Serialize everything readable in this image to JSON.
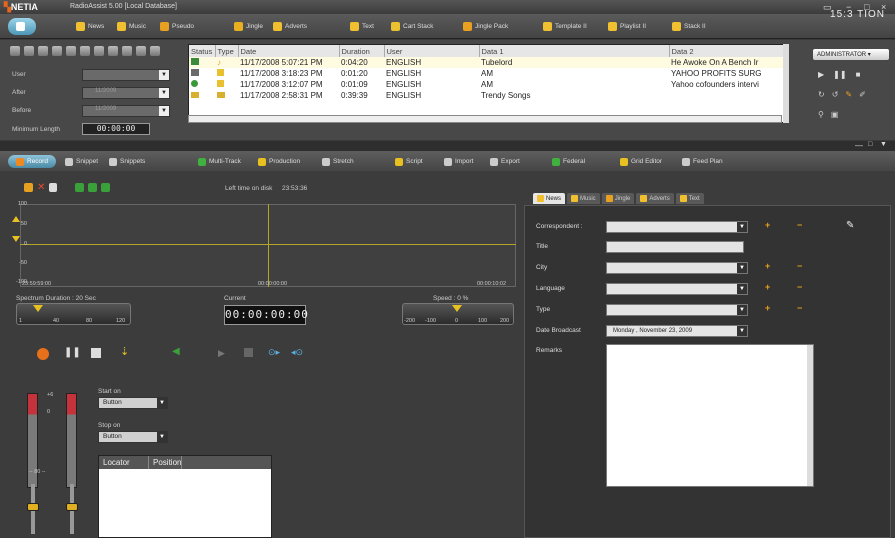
{
  "title_bar": {
    "logo": "NETIA",
    "window_title": "RadioAssist 5.00 [Local Database]",
    "controls": [
      "▭",
      "−",
      "□",
      "×"
    ]
  },
  "modules": [
    {
      "label": "",
      "icon": "home-icon",
      "color": "#ffffff",
      "active": true
    },
    {
      "label": "News",
      "icon": "news-icon",
      "color": "#f0c030"
    },
    {
      "label": "Music",
      "icon": "music-icon",
      "color": "#f0c030"
    },
    {
      "label": "Pseudo",
      "icon": "pseudo-icon",
      "color": "#e8a020"
    },
    {
      "label": "Jingle",
      "icon": "jingle-icon",
      "color": "#e8b020"
    },
    {
      "label": "Adverts",
      "icon": "adverts-icon",
      "color": "#f0c030"
    },
    {
      "label": "Text",
      "icon": "text-icon",
      "color": "#f0c030"
    },
    {
      "label": "Cart Stack",
      "icon": "cart-stack-icon",
      "color": "#e8c030"
    },
    {
      "label": "Jingle Pack",
      "icon": "jingle-pack-icon",
      "color": "#e8a020"
    },
    {
      "label": "Template II",
      "icon": "template-icon",
      "color": "#f0c030"
    },
    {
      "label": "Playlist II",
      "icon": "playlist-icon",
      "color": "#f0c030"
    },
    {
      "label": "Stack II",
      "icon": "stack-icon",
      "color": "#f0c030"
    }
  ],
  "clock": "15:3 TION",
  "filters": {
    "user_label": "User",
    "after_label": "After",
    "before_label": "Before",
    "after_value": "11/2009",
    "before_value": "11/2009",
    "min_length_label": "Minimum Length",
    "min_length_value": "00:00:00"
  },
  "grid": {
    "columns": [
      "Status",
      "Type",
      "Date",
      "Duration",
      "User",
      "Data 1",
      "Data 2"
    ],
    "rows": [
      {
        "date": "11/17/2008 5:07:21 PM",
        "duration": "0:04:20",
        "user": "ENGLISH",
        "data1": "Tubelord",
        "data2": "He Awoke On A Bench Ir"
      },
      {
        "date": "11/17/2008 3:18:23 PM",
        "duration": "0:01:20",
        "user": "ENGLISH",
        "data1": "AM",
        "data2": "YAHOO PROFITS SURG"
      },
      {
        "date": "11/17/2008 3:12:07 PM",
        "duration": "0:01:09",
        "user": "ENGLISH",
        "data1": "AM",
        "data2": "Yahoo cofounders intervi"
      },
      {
        "date": "11/17/2008 2:58:31 PM",
        "duration": "0:39:39",
        "user": "ENGLISH",
        "data1": "Trendy Songs",
        "data2": ""
      }
    ]
  },
  "admin_box": "ADMINISTRATOR",
  "subtabs": [
    {
      "label": "Record",
      "color": "#f08a20",
      "active": true
    },
    {
      "label": "Snippet",
      "color": "#cccccc"
    },
    {
      "label": "Snippets",
      "color": "#cccccc"
    },
    {
      "label": "Multi-Track",
      "color": "#40b040"
    },
    {
      "label": "Production",
      "color": "#e8c020"
    },
    {
      "label": "Stretch",
      "color": "#cccccc"
    },
    {
      "label": "Script",
      "color": "#e8c020"
    },
    {
      "label": "Import",
      "color": "#cccccc"
    },
    {
      "label": "Export",
      "color": "#cccccc"
    },
    {
      "label": "Federal",
      "color": "#40b040"
    },
    {
      "label": "Grid Editor",
      "color": "#e8c020"
    },
    {
      "label": "Feed Plan",
      "color": "#cccccc"
    }
  ],
  "editor": {
    "left_time_label": "Left time on disk",
    "left_time_value": "23:53:36",
    "wave_y_ticks": [
      "100",
      "50",
      "0",
      "-50",
      "-100"
    ],
    "wave_time_start": "23:59:59:00",
    "wave_time_mid": "00:00:00:00",
    "wave_time_end": "00:00:10:02",
    "spectrum_label": "Spectrum Duration : 20 Sec",
    "spectrum_ticks": [
      "1",
      "40",
      "80",
      "120"
    ],
    "current_label": "Current",
    "current_value": "00:00:00:00",
    "speed_label": "Speed : 0 %",
    "speed_ticks": [
      "-200",
      "-100",
      "0",
      "100",
      "200"
    ],
    "vu_ticks": [
      "+6",
      "0"
    ],
    "vu_bottom": "-- 80 --",
    "start_on_label": "Start on",
    "start_on_value": "Button",
    "stop_on_label": "Stop on",
    "stop_on_value": "Button",
    "locator_cols": [
      "Locator",
      "Position"
    ]
  },
  "form": {
    "tabs": [
      {
        "label": "News",
        "color": "#f0c030",
        "active": true
      },
      {
        "label": "Music",
        "color": "#f0c030"
      },
      {
        "label": "Jingle",
        "color": "#e8a020"
      },
      {
        "label": "Adverts",
        "color": "#f0c030"
      },
      {
        "label": "Text",
        "color": "#f0c030"
      }
    ],
    "correspondent_label": "Correspondent :",
    "title_label": "Title",
    "city_label": "City",
    "language_label": "Language",
    "type_label": "Type",
    "date_broadcast_label": "Date Broadcast",
    "date_broadcast_value": "Monday , November 23, 2009",
    "remarks_label": "Remarks"
  }
}
